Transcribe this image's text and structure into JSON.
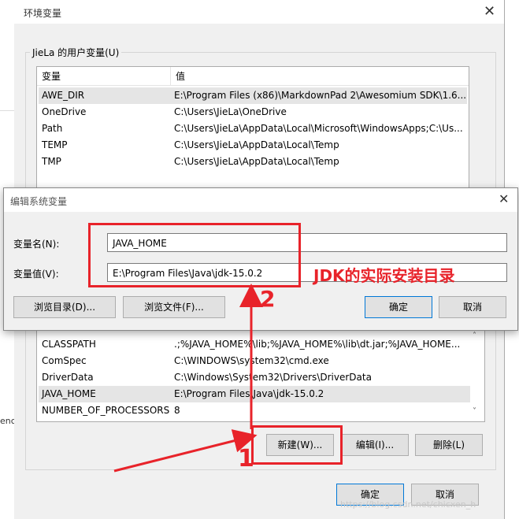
{
  "env": {
    "title": "环境变量",
    "user_group_label": "JieLa 的用户变量(U)",
    "col_var": "变量",
    "col_val": "值",
    "user_rows": [
      {
        "name": "AWE_DIR",
        "value": "E:\\Program Files (x86)\\MarkdownPad 2\\Awesomium SDK\\1.6..."
      },
      {
        "name": "OneDrive",
        "value": "C:\\Users\\JieLa\\OneDrive"
      },
      {
        "name": "Path",
        "value": "C:\\Users\\JieLa\\AppData\\Local\\Microsoft\\WindowsApps;C:\\Us..."
      },
      {
        "name": "TEMP",
        "value": "C:\\Users\\JieLa\\AppData\\Local\\Temp"
      },
      {
        "name": "TMP",
        "value": "C:\\Users\\JieLa\\AppData\\Local\\Temp"
      }
    ],
    "system_rows": [
      {
        "name": "CLASSPATH",
        "value": ".;%JAVA_HOME%\\lib;%JAVA_HOME%\\lib\\dt.jar;%JAVA_HOME..."
      },
      {
        "name": "ComSpec",
        "value": "C:\\WINDOWS\\system32\\cmd.exe"
      },
      {
        "name": "DriverData",
        "value": "C:\\Windows\\System32\\Drivers\\DriverData"
      },
      {
        "name": "JAVA_HOME",
        "value": "E:\\Program Files\\Java\\jdk-15.0.2"
      },
      {
        "name": "NUMBER_OF_PROCESSORS",
        "value": "8"
      }
    ],
    "new_btn": "新建(W)...",
    "edit_btn": "编辑(I)...",
    "delete_btn": "删除(L)",
    "ok_btn": "确定",
    "cancel_btn": "取消",
    "left_partial_text": "enc"
  },
  "edit": {
    "title": "编辑系统变量",
    "name_label": "变量名(N):",
    "name_value": "JAVA_HOME",
    "value_label": "变量值(V):",
    "value_value": "E:\\Program Files\\Java\\jdk-15.0.2",
    "browse_dir_btn": "浏览目录(D)...",
    "browse_file_btn": "浏览文件(F)...",
    "ok_btn": "确定",
    "cancel_btn": "取消"
  },
  "annotations": {
    "jdk_note": "JDK的实际安装目录",
    "step1": "1",
    "step2": "2"
  },
  "watermark": "https://blog.csdn.net/chicxen_h"
}
